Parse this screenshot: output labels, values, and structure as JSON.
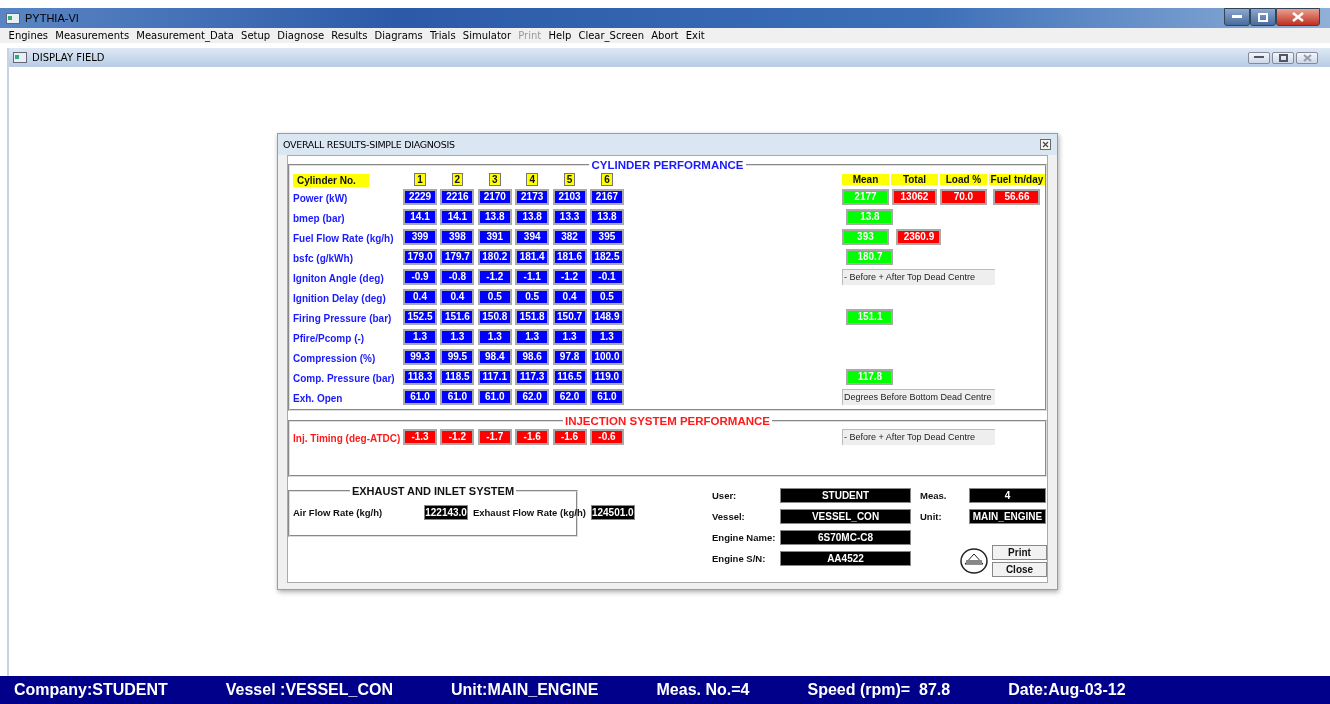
{
  "app": {
    "title": "PYTHIA-VI"
  },
  "menu": [
    {
      "label": "Engines",
      "disabled": false
    },
    {
      "label": "Measurements",
      "disabled": false
    },
    {
      "label": "Measurement_Data",
      "disabled": false
    },
    {
      "label": "Setup",
      "disabled": false
    },
    {
      "label": "Diagnose",
      "disabled": false
    },
    {
      "label": "Results",
      "disabled": false
    },
    {
      "label": "Diagrams",
      "disabled": false
    },
    {
      "label": "Trials",
      "disabled": false
    },
    {
      "label": "Simulator",
      "disabled": false
    },
    {
      "label": "Print",
      "disabled": true
    },
    {
      "label": "Help",
      "disabled": false
    },
    {
      "label": "Clear_Screen",
      "disabled": false
    },
    {
      "label": "Abort",
      "disabled": false
    },
    {
      "label": "Exit",
      "disabled": false
    }
  ],
  "child_window": {
    "title": "DISPLAY FIELD"
  },
  "dialog": {
    "title": "OVERALL RESULTS-SIMPLE DIAGNOSIS",
    "cylinder_performance": {
      "title": "CYLINDER PERFORMANCE",
      "row_header": "Cylinder No.",
      "cylinders": [
        "1",
        "2",
        "3",
        "4",
        "5",
        "6"
      ],
      "summary_headers": [
        "Mean",
        "Total",
        "Load %",
        "Fuel tn/day"
      ],
      "rows": [
        {
          "label": "Power (kW)",
          "values": [
            "2229",
            "2216",
            "2170",
            "2173",
            "2103",
            "2167"
          ],
          "summary": [
            {
              "text": "2177",
              "color": "#00ff00"
            },
            {
              "text": "13062",
              "color": "#ff0000"
            },
            {
              "text": "70.0",
              "color": "#ff0000"
            },
            {
              "text": "56.66",
              "color": "#ff0000"
            }
          ]
        },
        {
          "label": "bmep (bar)",
          "values": [
            "14.1",
            "14.1",
            "13.8",
            "13.8",
            "13.3",
            "13.8"
          ],
          "summary": [
            {
              "text": "13.8",
              "color": "#00ff00"
            }
          ]
        },
        {
          "label": "Fuel Flow Rate (kg/h)",
          "values": [
            "399",
            "398",
            "391",
            "394",
            "382",
            "395"
          ],
          "summary": [
            {
              "text": "393",
              "color": "#00ff00"
            },
            {
              "text": "2360.9",
              "color": "#ff0000"
            }
          ]
        },
        {
          "label": "bsfc (g/kWh)",
          "values": [
            "179.0",
            "179.7",
            "180.2",
            "181.4",
            "181.6",
            "182.5"
          ],
          "summary": [
            {
              "text": "180.7",
              "color": "#00ff00"
            }
          ]
        },
        {
          "label": "Igniton Angle (deg)",
          "values": [
            "-0.9",
            "-0.8",
            "-1.2",
            "-1.1",
            "-1.2",
            "-0.1"
          ],
          "note": "- Before  + After  Top Dead Centre"
        },
        {
          "label": "Ignition Delay (deg)",
          "values": [
            "0.4",
            "0.4",
            "0.5",
            "0.5",
            "0.4",
            "0.5"
          ]
        },
        {
          "label": "Firing Pressure (bar)",
          "values": [
            "152.5",
            "151.6",
            "150.8",
            "151.8",
            "150.7",
            "148.9"
          ],
          "summary": [
            {
              "text": "151.1",
              "color": "#00ff00"
            }
          ]
        },
        {
          "label": "Pfire/Pcomp (-)",
          "values": [
            "1.3",
            "1.3",
            "1.3",
            "1.3",
            "1.3",
            "1.3"
          ]
        },
        {
          "label": "Compression (%)",
          "values": [
            "99.3",
            "99.5",
            "98.4",
            "98.6",
            "97.8",
            "100.0"
          ]
        },
        {
          "label": "Comp. Pressure (bar)",
          "values": [
            "118.3",
            "118.5",
            "117.1",
            "117.3",
            "116.5",
            "119.0"
          ],
          "summary": [
            {
              "text": "117.8",
              "color": "#00ff00"
            }
          ]
        },
        {
          "label": "Exh. Open",
          "values": [
            "61.0",
            "61.0",
            "61.0",
            "62.0",
            "62.0",
            "61.0"
          ],
          "note": "Degrees Before Bottom Dead Centre"
        }
      ]
    },
    "injection": {
      "title": "INJECTION SYSTEM PERFORMANCE",
      "rows": [
        {
          "label": "Inj. Timing (deg-ATDC)",
          "values": [
            "-1.3",
            "-1.2",
            "-1.7",
            "-1.6",
            "-1.6",
            "-0.6"
          ],
          "note": "- Before  + After  Top Dead Centre"
        }
      ]
    },
    "exhaust_inlet": {
      "title": "EXHAUST AND INLET SYSTEM",
      "fields": [
        {
          "label": "Air Flow Rate (kg/h)",
          "value": "122143.0"
        },
        {
          "label": "Exhaust Flow Rate (kg/h)",
          "value": "124501.0"
        }
      ]
    },
    "info_rows": [
      {
        "fields": [
          {
            "label": "User:",
            "value": "STUDENT"
          },
          {
            "label": "Meas.",
            "value": "4"
          }
        ]
      },
      {
        "fields": [
          {
            "label": "Vessel:",
            "value": "VESSEL_CON"
          },
          {
            "label": "Unit:",
            "value": "MAIN_ENGINE"
          }
        ]
      },
      {
        "fields": [
          {
            "label": "Engine Name:",
            "value": "6S70MC-C8"
          }
        ]
      },
      {
        "fields": [
          {
            "label": "Engine S/N:",
            "value": "AA4522"
          }
        ]
      }
    ],
    "buttons": [
      "Print",
      "Close"
    ]
  },
  "status_bar": [
    "Company:STUDENT",
    "Vessel :VESSEL_CON",
    "Unit:MAIN_ENGINE",
    "Meas. No.=4",
    "Speed (rpm)=  87.8",
    "Date:Aug-03-12"
  ]
}
